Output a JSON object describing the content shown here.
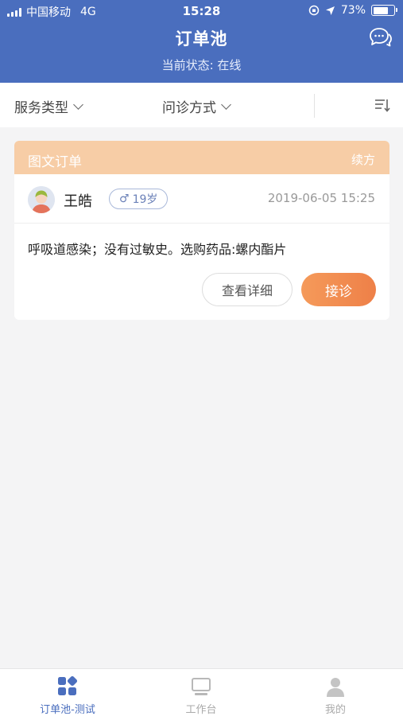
{
  "status_bar": {
    "carrier": "中国移动",
    "network": "4G",
    "time": "15:28",
    "battery": "73%",
    "battery_level": 0.73
  },
  "header": {
    "title": "订单池",
    "status_text": "当前状态: 在线"
  },
  "filters": {
    "service_type": "服务类型",
    "consult_method": "问诊方式"
  },
  "order_card": {
    "type_label": "图文订单",
    "tag": "续方",
    "patient_name": "王皓",
    "gender_symbol": "♂",
    "age": "19岁",
    "datetime": "2019-06-05 15:25",
    "description": "呼吸道感染；没有过敏史。选购药品:螺内酯片",
    "detail_button": "查看详细",
    "accept_button": "接诊"
  },
  "tabbar": {
    "tabs": [
      {
        "label": "订单池-测试",
        "icon": "grid-icon",
        "active": true
      },
      {
        "label": "工作台",
        "icon": "monitor-icon",
        "active": false
      },
      {
        "label": "我的",
        "icon": "user-icon",
        "active": false
      }
    ]
  },
  "colors": {
    "primary": "#4a6ebe",
    "card_header": "#f7cda6",
    "accent": "#ee8048"
  }
}
